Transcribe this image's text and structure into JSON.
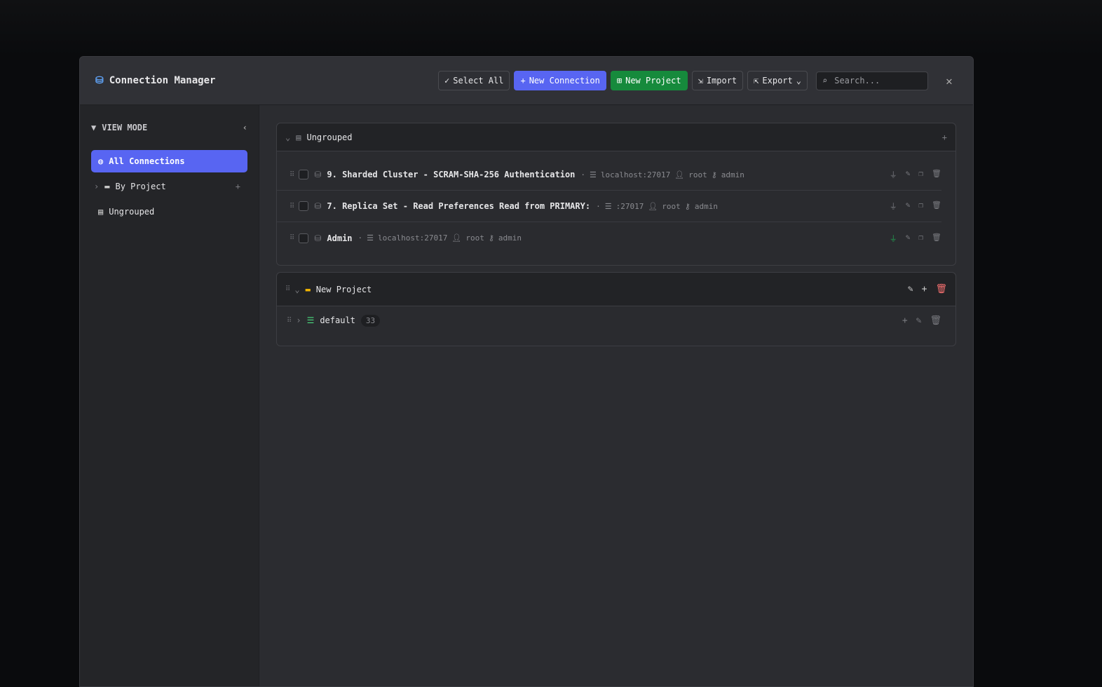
{
  "header": {
    "title": "Connection Manager",
    "select_all": "Select All",
    "new_connection": "New Connection",
    "new_project": "New Project",
    "import": "Import",
    "export": "Export",
    "search_placeholder": "Search..."
  },
  "sidebar": {
    "title": "VIEW MODE",
    "items": [
      {
        "label": "All Connections"
      },
      {
        "label": "By Project"
      },
      {
        "label": "Ungrouped"
      }
    ]
  },
  "ungrouped": {
    "title": "Ungrouped",
    "connections": [
      {
        "name": "9. Sharded Cluster - SCRAM-SHA-256 Authentication",
        "host": "localhost:27017",
        "user": "root",
        "db": "admin",
        "connected": false
      },
      {
        "name": "7. Replica Set - Read Preferences Read from PRIMARY:",
        "host": ":27017",
        "user": "root",
        "db": "admin",
        "connected": false
      },
      {
        "name": "Admin",
        "host": "localhost:27017",
        "user": "root",
        "db": "admin",
        "connected": true
      }
    ]
  },
  "project": {
    "title": "New Project",
    "env": {
      "name": "default",
      "count": "33"
    }
  },
  "colors": {
    "accent": "#5865f2",
    "green": "#168a3c",
    "danger": "#f87171",
    "folder": "#f5b700"
  }
}
